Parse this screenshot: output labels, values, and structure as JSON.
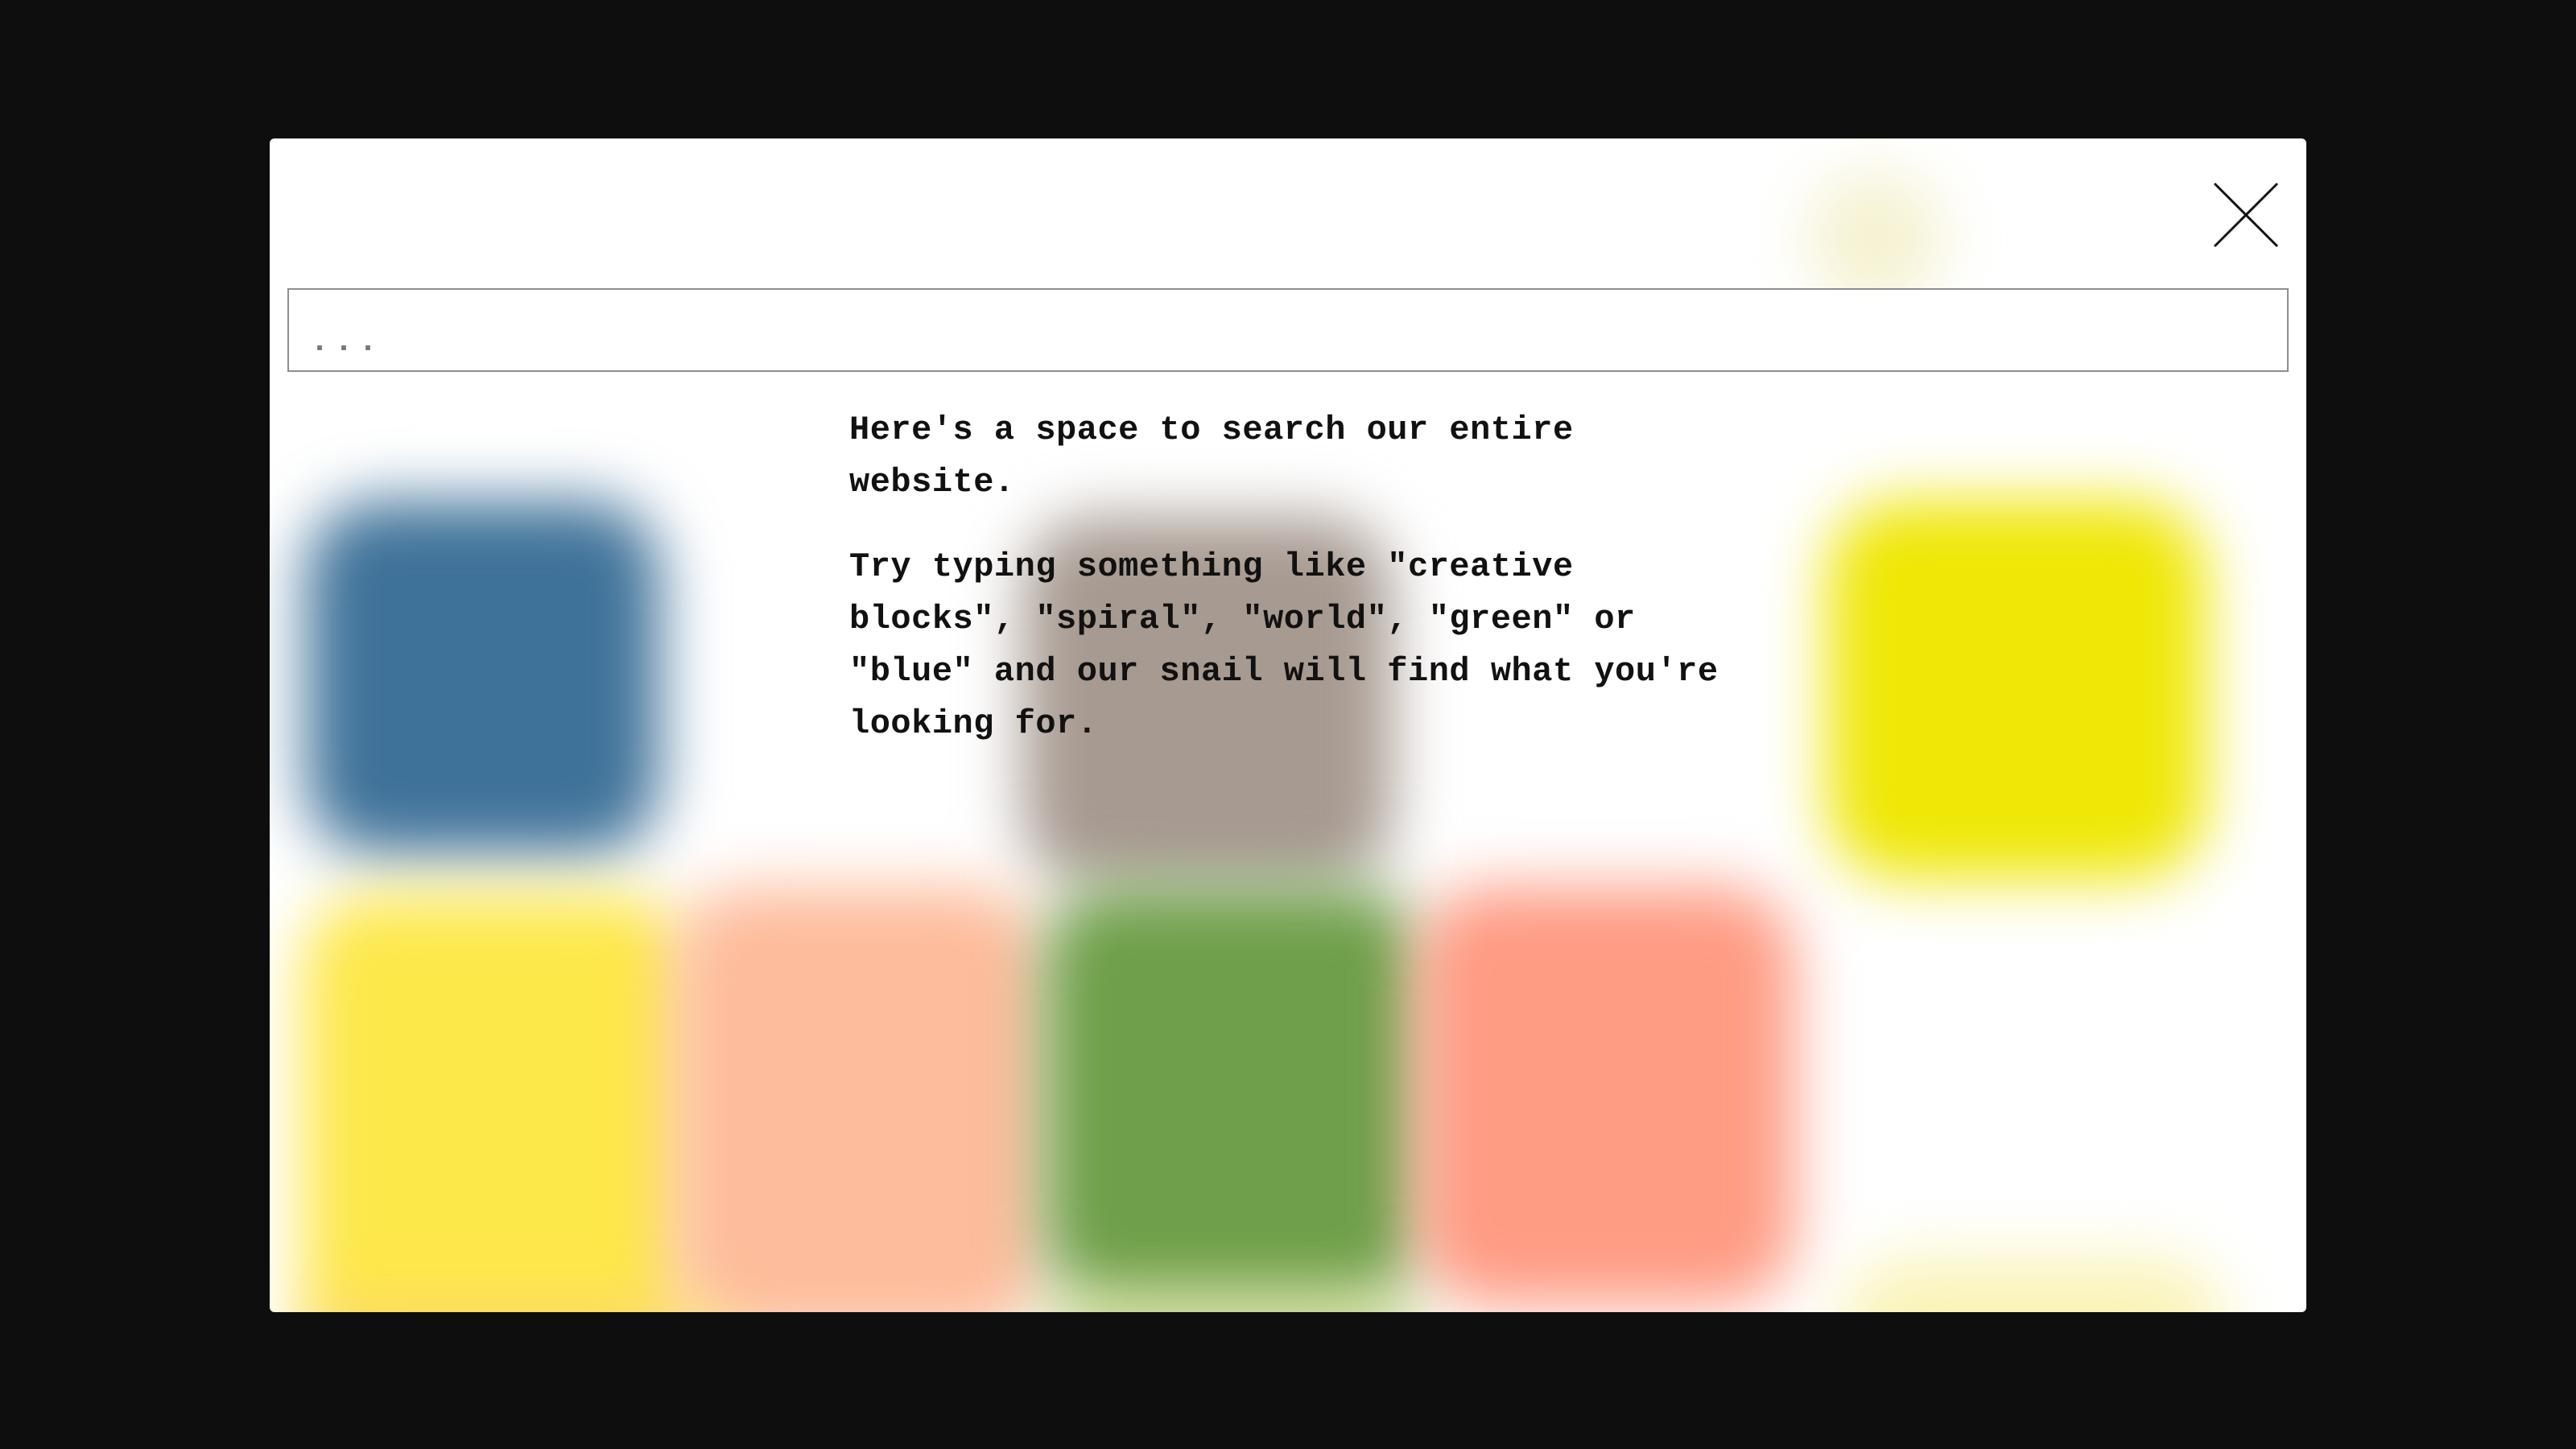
{
  "search": {
    "placeholder": "..."
  },
  "help": {
    "line1": "Here's a space to search our entire website.",
    "line2": "Try typing something like \"creative blocks\", \"spiral\", \"world\", \"green\" or \"blue\" and our snail will find what you're looking for."
  },
  "close": {
    "icon": "close-icon"
  },
  "colors": {
    "background": "#0e0e0e",
    "modal": "#ffffff",
    "blob_blue": "#3f7299",
    "blob_grey": "#a79a91",
    "blob_yellow": "#efe705",
    "blob_light_yellow": "#fde84a",
    "blob_peach": "#fdbc9b",
    "blob_green": "#6f9f4a",
    "blob_coral": "#fe9b83"
  }
}
